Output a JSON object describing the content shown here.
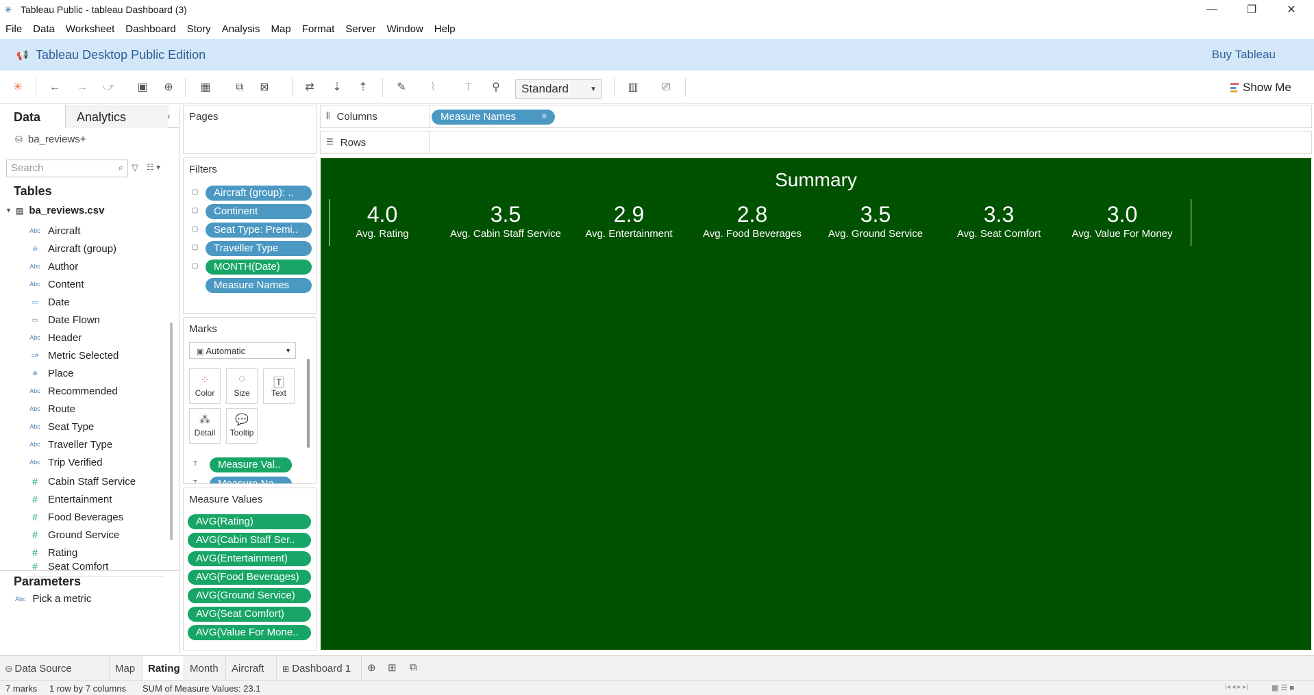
{
  "window": {
    "title": "Tableau Public - tableau Dashboard (3)",
    "controls": {
      "minimize": "—",
      "restore": "❐",
      "close": "✕"
    }
  },
  "menu": [
    "File",
    "Data",
    "Worksheet",
    "Dashboard",
    "Story",
    "Analysis",
    "Map",
    "Format",
    "Server",
    "Window",
    "Help"
  ],
  "banner": {
    "edition": "Tableau Desktop Public Edition",
    "buy": "Buy Tableau"
  },
  "toolbar": {
    "fit_mode": "Standard",
    "show_me": "Show Me"
  },
  "left_pane": {
    "tabs": {
      "data": "Data",
      "analytics": "Analytics"
    },
    "datasource": "ba_reviews+",
    "search_placeholder": "Search",
    "tables_heading": "Tables",
    "table_name": "ba_reviews.csv",
    "dimensions": [
      {
        "type": "Abc",
        "name": "Aircraft"
      },
      {
        "type": "link",
        "name": "Aircraft (group)"
      },
      {
        "type": "Abc",
        "name": "Author"
      },
      {
        "type": "Abc",
        "name": "Content"
      },
      {
        "type": "date",
        "name": "Date"
      },
      {
        "type": "date",
        "name": "Date Flown"
      },
      {
        "type": "Abc",
        "name": "Header"
      },
      {
        "type": "=#",
        "name": "Metric Selected"
      },
      {
        "type": "globe",
        "name": "Place"
      },
      {
        "type": "Abc",
        "name": "Recommended"
      },
      {
        "type": "Abc",
        "name": "Route"
      },
      {
        "type": "Abc",
        "name": "Seat Type"
      },
      {
        "type": "Abc",
        "name": "Traveller Type"
      },
      {
        "type": "Abc",
        "name": "Trip Verified"
      }
    ],
    "measures": [
      {
        "type": "#",
        "name": "Cabin Staff Service"
      },
      {
        "type": "#",
        "name": "Entertainment"
      },
      {
        "type": "#",
        "name": "Food Beverages"
      },
      {
        "type": "#",
        "name": "Ground Service"
      },
      {
        "type": "#",
        "name": "Rating"
      },
      {
        "type": "#",
        "name": "Seat Comfort"
      }
    ],
    "parameters_heading": "Parameters",
    "parameter": {
      "type": "Abc",
      "name": "Pick a metric"
    }
  },
  "pages_card": {
    "title": "Pages"
  },
  "filters_card": {
    "title": "Filters",
    "pills": [
      {
        "label": "Aircraft (group): ..",
        "color": "blue"
      },
      {
        "label": "Continent",
        "color": "blue"
      },
      {
        "label": "Seat Type: Premi..",
        "color": "blue"
      },
      {
        "label": "Traveller Type",
        "color": "blue"
      },
      {
        "label": "MONTH(Date)",
        "color": "green"
      },
      {
        "label": "Measure Names",
        "color": "blue"
      }
    ]
  },
  "marks_card": {
    "title": "Marks",
    "type": "Automatic",
    "buttons": [
      "Color",
      "Size",
      "Text",
      "Detail",
      "Tooltip"
    ],
    "pills": [
      "Measure Val..",
      "Measure Na.."
    ]
  },
  "measure_values_card": {
    "title": "Measure Values",
    "pills": [
      "AVG(Rating)",
      "AVG(Cabin Staff Ser..",
      "AVG(Entertainment)",
      "AVG(Food Beverages)",
      "AVG(Ground Service)",
      "AVG(Seat Comfort)",
      "AVG(Value For Mone.."
    ]
  },
  "shelves": {
    "columns_label": "Columns",
    "rows_label": "Rows",
    "columns_pill": "Measure Names"
  },
  "viz": {
    "title": "Summary",
    "kpis": [
      {
        "value": "4.0",
        "label": "Avg. Rating"
      },
      {
        "value": "3.5",
        "label": "Avg. Cabin Staff Service"
      },
      {
        "value": "2.9",
        "label": "Avg. Entertainment"
      },
      {
        "value": "2.8",
        "label": "Avg. Food Beverages"
      },
      {
        "value": "3.5",
        "label": "Avg. Ground Service"
      },
      {
        "value": "3.3",
        "label": "Avg. Seat Comfort"
      },
      {
        "value": "3.0",
        "label": "Avg. Value For Money"
      }
    ],
    "background": "#005200"
  },
  "sheet_tabs": {
    "data_source": "Data Source",
    "tabs": [
      "Map",
      "Rating",
      "Month",
      "Aircraft",
      "Dashboard 1"
    ],
    "active": "Rating"
  },
  "status": {
    "marks": "7 marks",
    "shape": "1 row by 7 columns",
    "sum": "SUM of Measure Values: 23.1"
  }
}
